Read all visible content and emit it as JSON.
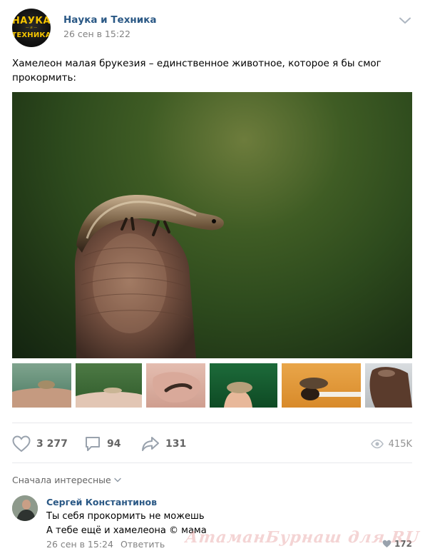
{
  "post": {
    "group_name": "Наука и Техника",
    "date": "26 сен в 15:22",
    "avatar_text": {
      "line1": "НАУКА",
      "line2": "ТЕХНИКА"
    },
    "text": "Хамелеон малая брукезия – единственное животное, которое я бы смог прокормить:"
  },
  "actions": {
    "likes": "3 277",
    "comments": "94",
    "shares": "131",
    "views": "415K"
  },
  "icons": {
    "more": "chevron-down-icon",
    "like": "heart-icon",
    "comment": "comment-bubble-icon",
    "share": "share-arrow-icon",
    "views": "eye-icon"
  },
  "comments_section": {
    "sort_label": "Сначала интересные",
    "comment": {
      "author": "Сергей Константинов",
      "line1": "Ты себя прокормить не можешь",
      "line2": "А тебе ещё и хамелеона © мама",
      "date": "26 сен в 15:24",
      "reply_label": "Ответить",
      "likes": "172"
    }
  },
  "watermark": "АтаманБурнаш для RU",
  "colors": {
    "link": "#2a5885",
    "muted": "#828282",
    "icon": "#99a2ad",
    "divider": "#e7e8ec"
  }
}
